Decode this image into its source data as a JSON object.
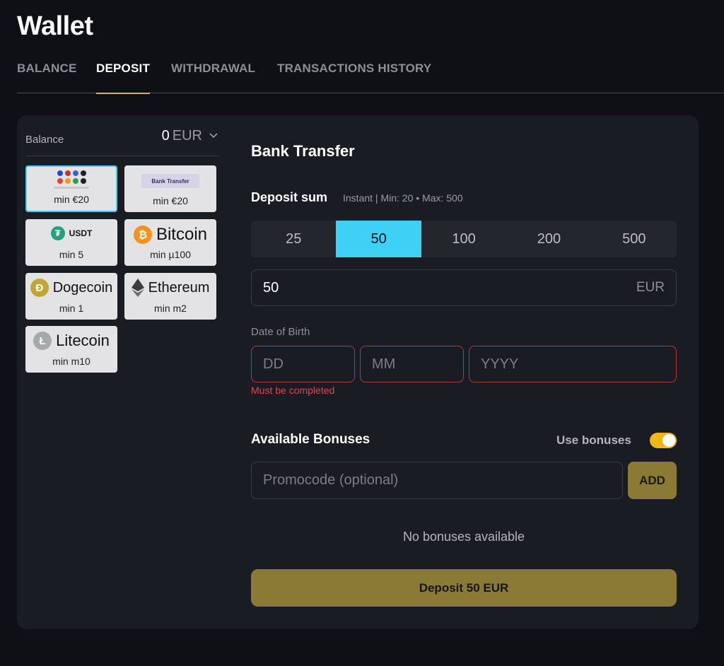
{
  "page": {
    "title": "Wallet"
  },
  "tabs": [
    {
      "label": "BALANCE"
    },
    {
      "label": "DEPOSIT"
    },
    {
      "label": "WITHDRAWAL"
    },
    {
      "label": "TRANSACTIONS HISTORY"
    }
  ],
  "balance": {
    "label": "Balance",
    "amount": "0",
    "currency": "EUR"
  },
  "methods": [
    {
      "brand": "",
      "min": "min €20",
      "selected": true
    },
    {
      "brand": "Bank Transfer",
      "min": "min €20"
    },
    {
      "brand": "USDT",
      "min": "min 5",
      "icon": "tether-icon",
      "color": "#26a17b"
    },
    {
      "brand": "Bitcoin",
      "min": "min µ100",
      "icon": "bitcoin-icon",
      "color": "#f7931a"
    },
    {
      "brand": "Dogecoin",
      "min": "min 1",
      "icon": "dogecoin-icon",
      "color": "#c2a633"
    },
    {
      "brand": "Ethereum",
      "min": "min m2",
      "icon": "ethereum-icon",
      "color": "#3c3c3d"
    },
    {
      "brand": "Litecoin",
      "min": "min m10",
      "icon": "litecoin-icon",
      "color": "#a6a9aa"
    }
  ],
  "form": {
    "title": "Bank Transfer",
    "deposit_sum_label": "Deposit sum",
    "deposit_info": "Instant | Min: 20 • Max: 500",
    "amounts": [
      "25",
      "50",
      "100",
      "200",
      "500"
    ],
    "selected_amount": "50",
    "amount_value": "50",
    "amount_currency": "EUR",
    "dob_label": "Date of Birth",
    "dob_placeholders": {
      "day": "DD",
      "month": "MM",
      "year": "YYYY"
    },
    "dob_error": "Must be completed",
    "bonuses_title": "Available Bonuses",
    "use_bonuses_label": "Use bonuses",
    "use_bonuses_on": true,
    "promo_placeholder": "Promocode (optional)",
    "add_label": "ADD",
    "no_bonuses": "No bonuses available",
    "deposit_button": "Deposit 50 EUR"
  },
  "colors": {
    "accent": "#3fd0f5",
    "gold": "#8b7a36",
    "toggle": "#f2b619",
    "error": "#e0454e",
    "tab_underline": "#d8b25a"
  }
}
